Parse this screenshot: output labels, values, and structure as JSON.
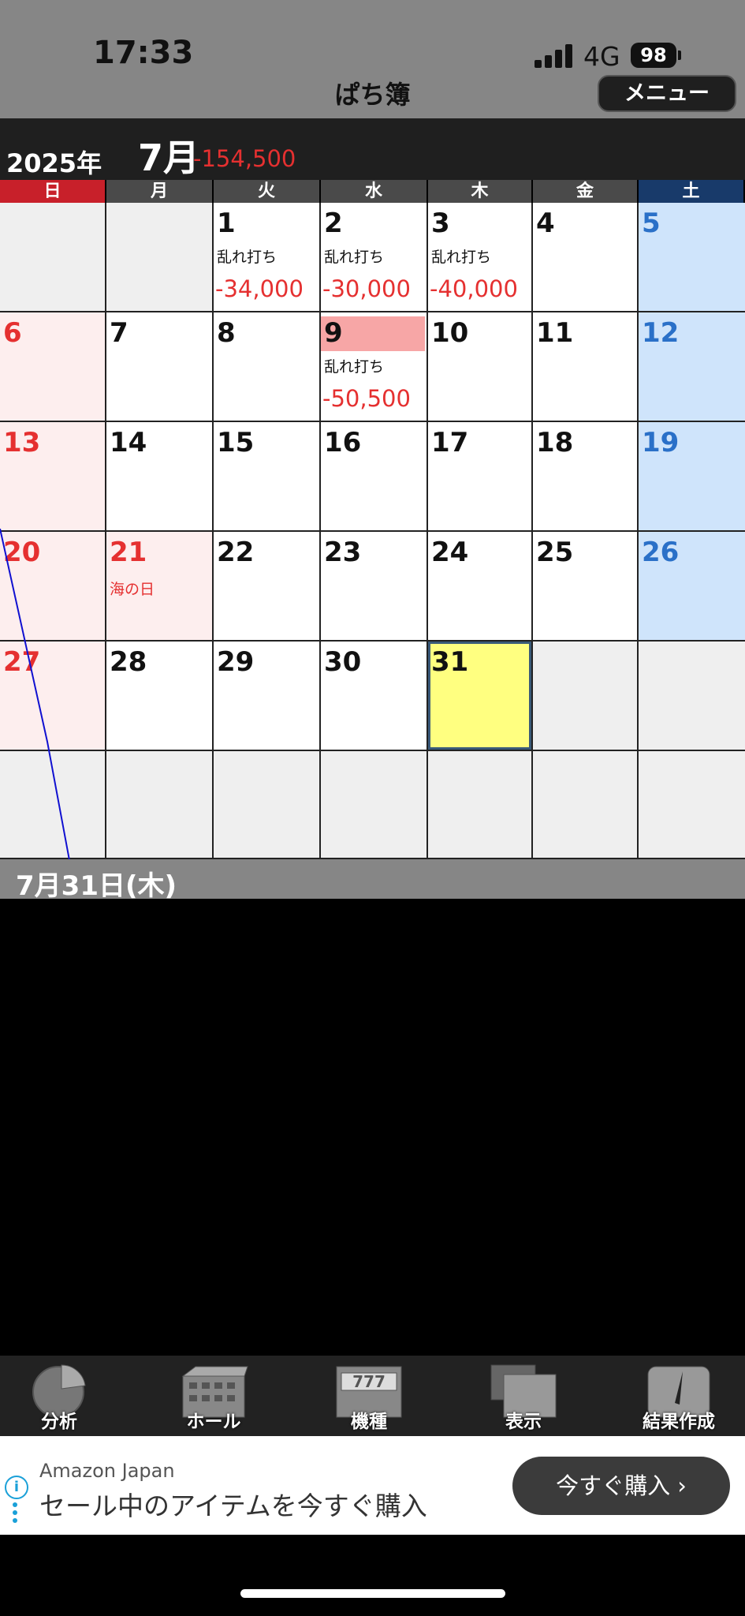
{
  "status": {
    "time": "17:33",
    "network": "4G",
    "battery": "98"
  },
  "header": {
    "title": "ぱち簿",
    "menu_label": "メニュー"
  },
  "calendar": {
    "year_label": "2025年",
    "month_label": "7月",
    "month_total": "-154,500",
    "weekdays": [
      "日",
      "月",
      "火",
      "水",
      "木",
      "金",
      "土"
    ],
    "weekday_colors": [
      "#c8202a",
      "#4a4a4a",
      "#4a4a4a",
      "#4a4a4a",
      "#4a4a4a",
      "#4a4a4a",
      "#183a6a"
    ],
    "weeks": [
      [
        {
          "day": ""
        },
        {
          "day": ""
        },
        {
          "day": "1",
          "memo": "乱れ打ち",
          "amount": "-34,000"
        },
        {
          "day": "2",
          "memo": "乱れ打ち",
          "amount": "-30,000"
        },
        {
          "day": "3",
          "memo": "乱れ打ち",
          "amount": "-40,000"
        },
        {
          "day": "4"
        },
        {
          "day": "5"
        }
      ],
      [
        {
          "day": "6"
        },
        {
          "day": "7"
        },
        {
          "day": "8"
        },
        {
          "day": "9",
          "memo": "乱れ打ち",
          "amount": "-50,500",
          "highlight": true
        },
        {
          "day": "10"
        },
        {
          "day": "11"
        },
        {
          "day": "12"
        }
      ],
      [
        {
          "day": "13"
        },
        {
          "day": "14"
        },
        {
          "day": "15"
        },
        {
          "day": "16"
        },
        {
          "day": "17"
        },
        {
          "day": "18"
        },
        {
          "day": "19"
        }
      ],
      [
        {
          "day": "20"
        },
        {
          "day": "21",
          "holiday": "海の日"
        },
        {
          "day": "22"
        },
        {
          "day": "23"
        },
        {
          "day": "24"
        },
        {
          "day": "25"
        },
        {
          "day": "26"
        }
      ],
      [
        {
          "day": "27"
        },
        {
          "day": "28"
        },
        {
          "day": "29"
        },
        {
          "day": "30"
        },
        {
          "day": "31",
          "today": true
        },
        {
          "day": ""
        },
        {
          "day": ""
        }
      ],
      [
        {
          "day": ""
        },
        {
          "day": ""
        },
        {
          "day": ""
        },
        {
          "day": ""
        },
        {
          "day": ""
        },
        {
          "day": ""
        },
        {
          "day": ""
        }
      ]
    ]
  },
  "selected_date": "7月31日(木)",
  "toolbar": [
    {
      "label": "分析",
      "icon": "pie-chart-icon"
    },
    {
      "label": "ホール",
      "icon": "building-icon"
    },
    {
      "label": "機種",
      "icon": "slot-machine-icon"
    },
    {
      "label": "表示",
      "icon": "display-icon"
    },
    {
      "label": "結果作成",
      "icon": "pen-icon"
    }
  ],
  "ad": {
    "source": "Amazon Japan",
    "text": "セール中のアイテムを今すぐ購入",
    "button": "今すぐ購入 ›"
  },
  "colors": {
    "loss": "#e53030",
    "sunday": "#e53030",
    "saturday": "#2a70c8",
    "today": "#ffff80"
  }
}
